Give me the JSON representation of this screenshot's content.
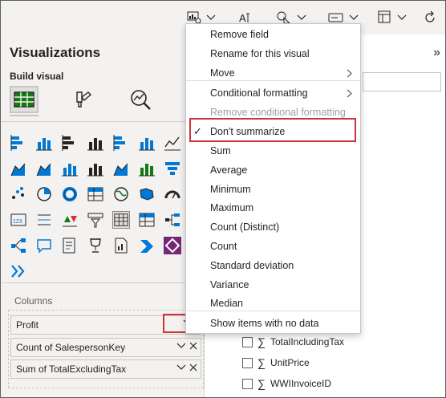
{
  "colors": {
    "highlight": "#d13438",
    "pane_bg": "#f3f2f1",
    "accent_green": "#107c10",
    "accent_blue": "#0078d4"
  },
  "visualizations_pane": {
    "title": "Visualizations",
    "build_label": "Build visual",
    "build_tabs": [
      {
        "icon": "build-visual-icon",
        "active": true
      },
      {
        "icon": "format-visual-icon",
        "active": false
      },
      {
        "icon": "analytics-icon",
        "active": false
      }
    ],
    "visual_icons": [
      "stacked-bar-icon",
      "stacked-column-icon",
      "clustered-bar-icon",
      "clustered-column-icon",
      "100-stacked-bar-icon",
      "100-stacked-column-icon",
      "line-chart-icon",
      "area-chart-icon",
      "stacked-area-icon",
      "line-clustered-column-icon",
      "line-stacked-column-icon",
      "ribbon-chart-icon",
      "waterfall-icon",
      "funnel-icon",
      "scatter-icon",
      "pie-icon",
      "donut-icon",
      "treemap-icon",
      "map-icon",
      "filled-map-icon",
      "gauge-icon",
      "card-icon",
      "multirow-card-icon",
      "kpi-icon",
      "slicer-icon",
      "table-icon",
      "matrix-icon",
      "decomposition-tree-icon",
      "key-influencers-icon",
      "qa-icon",
      "smart-narrative-icon",
      "goals-icon",
      "paginated-report-icon",
      "power-automate-icon",
      "power-apps-icon",
      "more-visuals-icon"
    ],
    "selected_visual_index": 25,
    "columns_label": "Columns",
    "fields": [
      {
        "label": "Profit"
      },
      {
        "label": "Count of SalespersonKey"
      },
      {
        "label": "Sum of TotalExcludingTax"
      }
    ]
  },
  "context_menu": {
    "items": [
      {
        "label": "Remove field"
      },
      {
        "label": "Rename for this visual"
      },
      {
        "label": "Move",
        "submenu": true
      },
      {
        "label": "Conditional formatting",
        "submenu": true
      },
      {
        "label": "Remove conditional formatting",
        "disabled": true
      },
      {
        "label": "Don't summarize",
        "checked": true
      },
      {
        "label": "Sum"
      },
      {
        "label": "Average"
      },
      {
        "label": "Minimum"
      },
      {
        "label": "Maximum"
      },
      {
        "label": "Count (Distinct)"
      },
      {
        "label": "Count"
      },
      {
        "label": "Standard deviation"
      },
      {
        "label": "Variance"
      },
      {
        "label": "Median"
      },
      {
        "label": "Show items with no data"
      }
    ]
  },
  "data_pane": {
    "collapse_glyph": "»",
    "fields": [
      {
        "label": "TotalIncludingTax"
      },
      {
        "label": "UnitPrice"
      },
      {
        "label": "WWIInvoiceID"
      }
    ]
  }
}
